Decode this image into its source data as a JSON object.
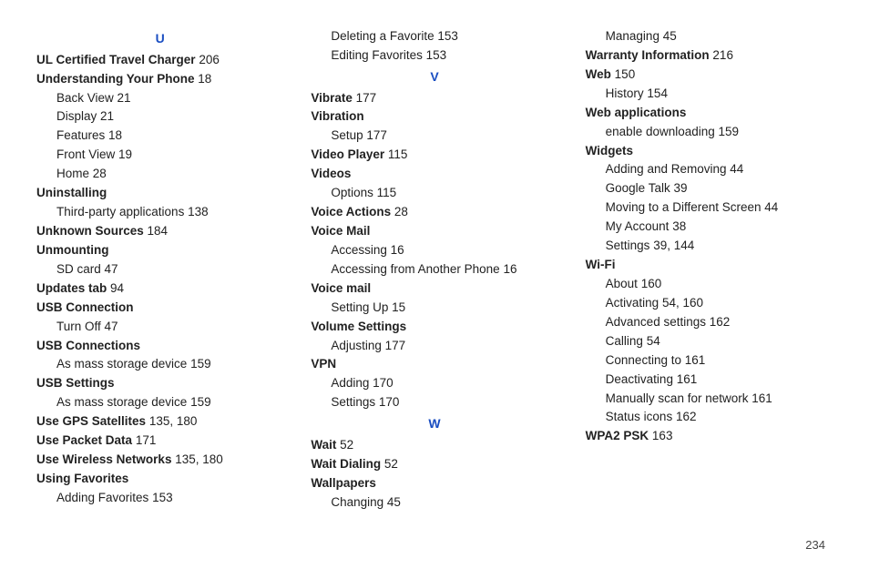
{
  "page_number": "234",
  "sections": [
    {
      "letter": "U",
      "items": [
        {
          "label": "UL Certified Travel Charger",
          "page": "206",
          "bold": true,
          "sub": false
        },
        {
          "label": "Understanding Your Phone",
          "page": "18",
          "bold": true,
          "sub": false
        },
        {
          "label": "Back View",
          "page": "21",
          "bold": false,
          "sub": true
        },
        {
          "label": "Display",
          "page": "21",
          "bold": false,
          "sub": true
        },
        {
          "label": "Features",
          "page": "18",
          "bold": false,
          "sub": true
        },
        {
          "label": "Front View",
          "page": "19",
          "bold": false,
          "sub": true
        },
        {
          "label": "Home",
          "page": "28",
          "bold": false,
          "sub": true
        },
        {
          "label": "Uninstalling",
          "page": "",
          "bold": true,
          "sub": false
        },
        {
          "label": "Third-party applications",
          "page": "138",
          "bold": false,
          "sub": true
        },
        {
          "label": "Unknown Sources",
          "page": "184",
          "bold": true,
          "sub": false
        },
        {
          "label": "Unmounting",
          "page": "",
          "bold": true,
          "sub": false
        },
        {
          "label": "SD card",
          "page": "47",
          "bold": false,
          "sub": true
        },
        {
          "label": "Updates tab",
          "page": "94",
          "bold": true,
          "sub": false
        },
        {
          "label": "USB Connection",
          "page": "",
          "bold": true,
          "sub": false
        },
        {
          "label": "Turn Off",
          "page": "47",
          "bold": false,
          "sub": true
        },
        {
          "label": "USB Connections",
          "page": "",
          "bold": true,
          "sub": false
        },
        {
          "label": "As mass storage device",
          "page": "159",
          "bold": false,
          "sub": true
        },
        {
          "label": "USB Settings",
          "page": "",
          "bold": true,
          "sub": false
        },
        {
          "label": "As mass storage device",
          "page": "159",
          "bold": false,
          "sub": true
        },
        {
          "label": "Use GPS Satellites",
          "page": "135, 180",
          "bold": true,
          "sub": false
        },
        {
          "label": "Use Packet Data",
          "page": "171",
          "bold": true,
          "sub": false
        },
        {
          "label": "Use Wireless Networks",
          "page": "135, 180",
          "bold": true,
          "sub": false
        },
        {
          "label": "Using Favorites",
          "page": "",
          "bold": true,
          "sub": false
        },
        {
          "label": "Adding Favorites",
          "page": "153",
          "bold": false,
          "sub": true
        },
        {
          "label": "Deleting a Favorite",
          "page": "153",
          "bold": false,
          "sub": true
        },
        {
          "label": "Editing Favorites",
          "page": "153",
          "bold": false,
          "sub": true
        }
      ]
    },
    {
      "letter": "V",
      "items": [
        {
          "label": "Vibrate",
          "page": "177",
          "bold": true,
          "sub": false
        },
        {
          "label": "Vibration",
          "page": "",
          "bold": true,
          "sub": false
        },
        {
          "label": "Setup",
          "page": "177",
          "bold": false,
          "sub": true
        },
        {
          "label": "Video Player",
          "page": "115",
          "bold": true,
          "sub": false
        },
        {
          "label": "Videos",
          "page": "",
          "bold": true,
          "sub": false
        },
        {
          "label": "Options",
          "page": "115",
          "bold": false,
          "sub": true
        },
        {
          "label": "Voice Actions",
          "page": "28",
          "bold": true,
          "sub": false
        },
        {
          "label": "Voice Mail",
          "page": "",
          "bold": true,
          "sub": false
        },
        {
          "label": "Accessing",
          "page": "16",
          "bold": false,
          "sub": true
        },
        {
          "label": "Accessing from Another Phone",
          "page": "16",
          "bold": false,
          "sub": true
        },
        {
          "label": "Voice mail",
          "page": "",
          "bold": true,
          "sub": false
        },
        {
          "label": "Setting Up",
          "page": "15",
          "bold": false,
          "sub": true
        },
        {
          "label": "Volume Settings",
          "page": "",
          "bold": true,
          "sub": false
        },
        {
          "label": "Adjusting",
          "page": "177",
          "bold": false,
          "sub": true
        },
        {
          "label": "VPN",
          "page": "",
          "bold": true,
          "sub": false
        },
        {
          "label": "Adding",
          "page": "170",
          "bold": false,
          "sub": true
        },
        {
          "label": "Settings",
          "page": "170",
          "bold": false,
          "sub": true
        }
      ]
    },
    {
      "letter": "W",
      "items": [
        {
          "label": "Wait",
          "page": "52",
          "bold": true,
          "sub": false
        },
        {
          "label": "Wait Dialing",
          "page": "52",
          "bold": true,
          "sub": false
        },
        {
          "label": "Wallpapers",
          "page": "",
          "bold": true,
          "sub": false
        },
        {
          "label": "Changing",
          "page": "45",
          "bold": false,
          "sub": true
        },
        {
          "label": "Managing",
          "page": "45",
          "bold": false,
          "sub": true
        },
        {
          "label": "Warranty Information",
          "page": "216",
          "bold": true,
          "sub": false
        },
        {
          "label": "Web",
          "page": "150",
          "bold": true,
          "sub": false
        },
        {
          "label": "History",
          "page": "154",
          "bold": false,
          "sub": true
        },
        {
          "label": "Web applications",
          "page": "",
          "bold": true,
          "sub": false
        },
        {
          "label": "enable downloading",
          "page": "159",
          "bold": false,
          "sub": true
        },
        {
          "label": "Widgets",
          "page": "",
          "bold": true,
          "sub": false
        },
        {
          "label": "Adding and Removing",
          "page": "44",
          "bold": false,
          "sub": true
        },
        {
          "label": "Google Talk",
          "page": "39",
          "bold": false,
          "sub": true
        },
        {
          "label": "Moving to a Different Screen",
          "page": "44",
          "bold": false,
          "sub": true
        },
        {
          "label": "My Account",
          "page": "38",
          "bold": false,
          "sub": true
        },
        {
          "label": "Settings",
          "page": "39, 144",
          "bold": false,
          "sub": true
        },
        {
          "label": "Wi-Fi",
          "page": "",
          "bold": true,
          "sub": false
        },
        {
          "label": "About",
          "page": "160",
          "bold": false,
          "sub": true
        },
        {
          "label": "Activating",
          "page": "54, 160",
          "bold": false,
          "sub": true
        },
        {
          "label": "Advanced settings",
          "page": "162",
          "bold": false,
          "sub": true
        },
        {
          "label": "Calling",
          "page": "54",
          "bold": false,
          "sub": true
        },
        {
          "label": "Connecting to",
          "page": "161",
          "bold": false,
          "sub": true
        },
        {
          "label": "Deactivating",
          "page": "161",
          "bold": false,
          "sub": true
        },
        {
          "label": "Manually scan for network",
          "page": "161",
          "bold": false,
          "sub": true
        },
        {
          "label": "Status icons",
          "page": "162",
          "bold": false,
          "sub": true
        },
        {
          "label": "WPA2 PSK",
          "page": "163",
          "bold": true,
          "sub": false
        }
      ]
    }
  ]
}
